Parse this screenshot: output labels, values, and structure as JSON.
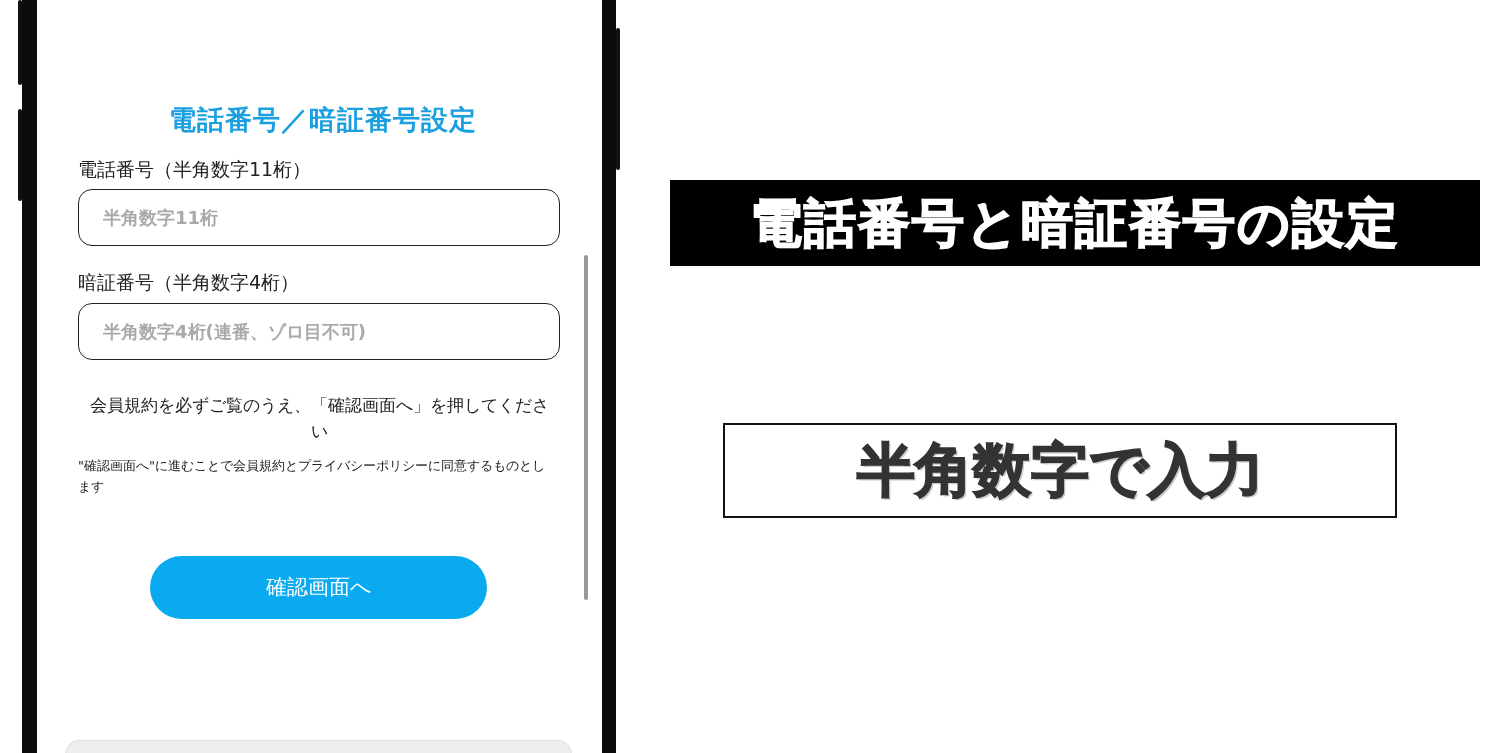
{
  "screen": {
    "title": "電話番号／暗証番号設定",
    "fields": [
      {
        "label": "電話番号（半角数字11桁）",
        "placeholder": "半角数字11桁"
      },
      {
        "label": "暗証番号（半角数字4桁）",
        "placeholder": "半角数字4桁(連番、ゾロ目不可)"
      }
    ],
    "notice": "会員規約を必ずご覧のうえ、「確認画面へ」を押してください",
    "consent": "\"確認画面へ\"に進むことで会員規約とプライバシーポリシーに同意するものとします",
    "button": "確認画面へ"
  },
  "captions": [
    {
      "kind": "banner",
      "text": "電話番号と暗証番号の設定"
    },
    {
      "kind": "boxed",
      "text": "半角数字で入力"
    }
  ]
}
